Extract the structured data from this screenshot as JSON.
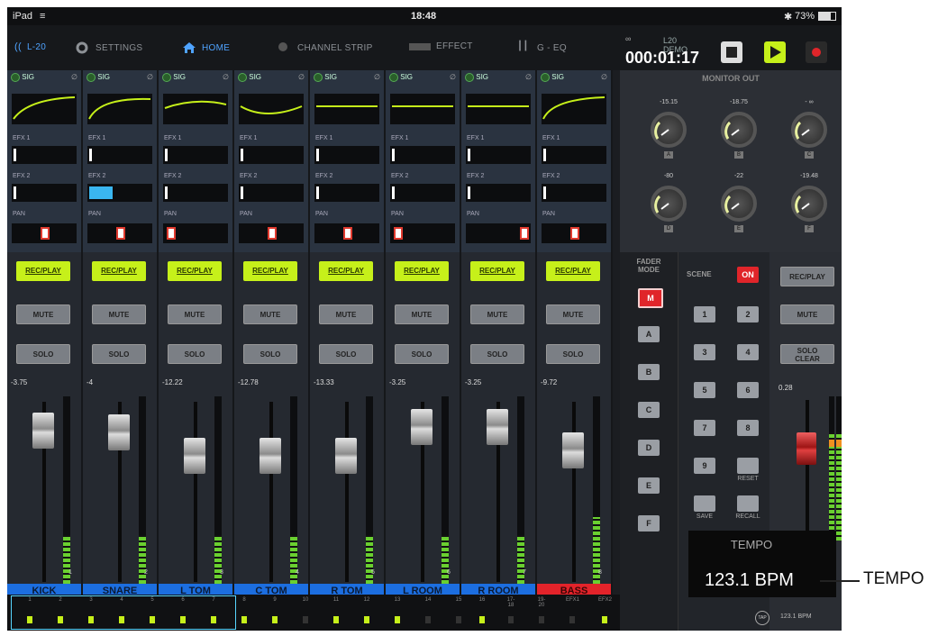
{
  "status": {
    "device": "iPad",
    "time": "18:48",
    "battery": "73%"
  },
  "nav": {
    "l20": "L-20",
    "settings": "SETTINGS",
    "home": "HOME",
    "channel_strip": "CHANNEL STRIP",
    "effect": "EFFECT",
    "geq": "G - EQ",
    "demo": "L20 DEMO",
    "timecode": "000:01:17"
  },
  "labels": {
    "sig": "SIG",
    "efx1": "EFX 1",
    "efx2": "EFX 2",
    "pan": "PAN",
    "recplay": "REC/PLAY",
    "mute": "MUTE",
    "solo": "SOLO"
  },
  "channels": [
    {
      "name": "KICK",
      "level": "-3.75",
      "num": "1"
    },
    {
      "name": "SNARE",
      "level": "-4",
      "num": "2"
    },
    {
      "name": "L TOM",
      "level": "-12.22",
      "num": "3"
    },
    {
      "name": "C TOM",
      "level": "-12.78",
      "num": "4"
    },
    {
      "name": "R TOM",
      "level": "-13.33",
      "num": "5"
    },
    {
      "name": "L ROOM",
      "level": "-3.25",
      "num": "6"
    },
    {
      "name": "R ROOM",
      "level": "-3.25",
      "num": "7"
    },
    {
      "name": "BASS",
      "level": "-9.72",
      "num": "8"
    }
  ],
  "monitor": {
    "title": "MONITOR OUT",
    "knobs": [
      {
        "value": "-15.15",
        "letter": "A"
      },
      {
        "value": "-18.75",
        "letter": "B"
      },
      {
        "value": "- ∞",
        "letter": "C"
      },
      {
        "value": "-80",
        "letter": "D"
      },
      {
        "value": "-22",
        "letter": "E"
      },
      {
        "value": "-19.48",
        "letter": "F"
      }
    ]
  },
  "fader_mode": {
    "title1": "FADER",
    "title2": "MODE",
    "buttons": [
      "M",
      "A",
      "B",
      "C",
      "D",
      "E",
      "F"
    ]
  },
  "scene": {
    "title": "SCENE",
    "on": "ON",
    "numbers": [
      "1",
      "2",
      "3",
      "4",
      "5",
      "6",
      "7",
      "8",
      "9"
    ],
    "reset": "RESET",
    "save": "SAVE",
    "recall": "RECALL"
  },
  "master": {
    "recplay": "REC/PLAY",
    "mute": "MUTE",
    "solo_clear1": "SOLO",
    "solo_clear2": "CLEAR",
    "level": "0.28"
  },
  "bottom": {
    "labels": [
      "1",
      "2",
      "3",
      "4",
      "5",
      "6",
      "7",
      "8",
      "9",
      "10",
      "11",
      "12",
      "13",
      "14",
      "15",
      "16",
      "17-18",
      "19-20",
      "EFX1",
      "EFX2"
    ],
    "tap": "TAP",
    "bpm_small": "123.1 BPM"
  },
  "tempo": {
    "title": "TEMPO",
    "value": "123.1 BPM",
    "callout": "TEMPO"
  }
}
